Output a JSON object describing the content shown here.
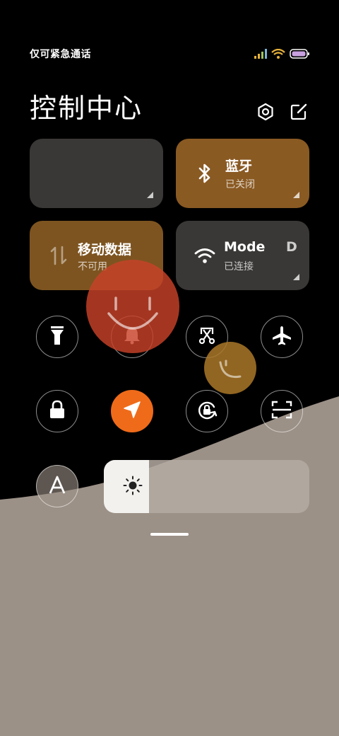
{
  "status_bar": {
    "carrier_text": "仅可紧急通话",
    "icons": [
      "signal-icon",
      "wifi-icon",
      "battery-icon"
    ]
  },
  "header": {
    "title": "控制中心",
    "settings_icon": "settings-icon",
    "edit_icon": "edit-icon"
  },
  "tiles": {
    "media": {
      "title": "",
      "subtitle": ""
    },
    "bluetooth": {
      "title": "蓝牙",
      "subtitle": "已关闭",
      "icon": "bluetooth-icon"
    },
    "mobile_data": {
      "title": "移动数据",
      "subtitle": "不可用",
      "icon": "data-arrows-icon"
    },
    "wifi": {
      "title": "Mode",
      "title_suffix": "D",
      "subtitle": "已连接",
      "icon": "wifi-icon"
    }
  },
  "toggles": [
    {
      "id": "flashlight",
      "icon": "flashlight-icon",
      "active": false
    },
    {
      "id": "silent",
      "icon": "bell-icon",
      "active": false
    },
    {
      "id": "screenshot",
      "icon": "scissors-icon",
      "active": false
    },
    {
      "id": "airplane",
      "icon": "airplane-icon",
      "active": false
    },
    {
      "id": "lock",
      "icon": "lock-icon",
      "active": false
    },
    {
      "id": "location",
      "icon": "location-arrow-icon",
      "active": true
    },
    {
      "id": "rotation",
      "icon": "rotation-lock-icon",
      "active": false
    },
    {
      "id": "scanner",
      "icon": "scan-icon",
      "active": false
    },
    {
      "id": "font",
      "icon": "font-a-icon",
      "active": false
    }
  ],
  "brightness": {
    "level": 0.22,
    "icon": "sun-icon"
  },
  "colors": {
    "accent_orange": "#ef6b1a",
    "tile_orange": "#8a5a23",
    "tile_dark": "#3a3836",
    "wallpaper": "#9c9187"
  }
}
